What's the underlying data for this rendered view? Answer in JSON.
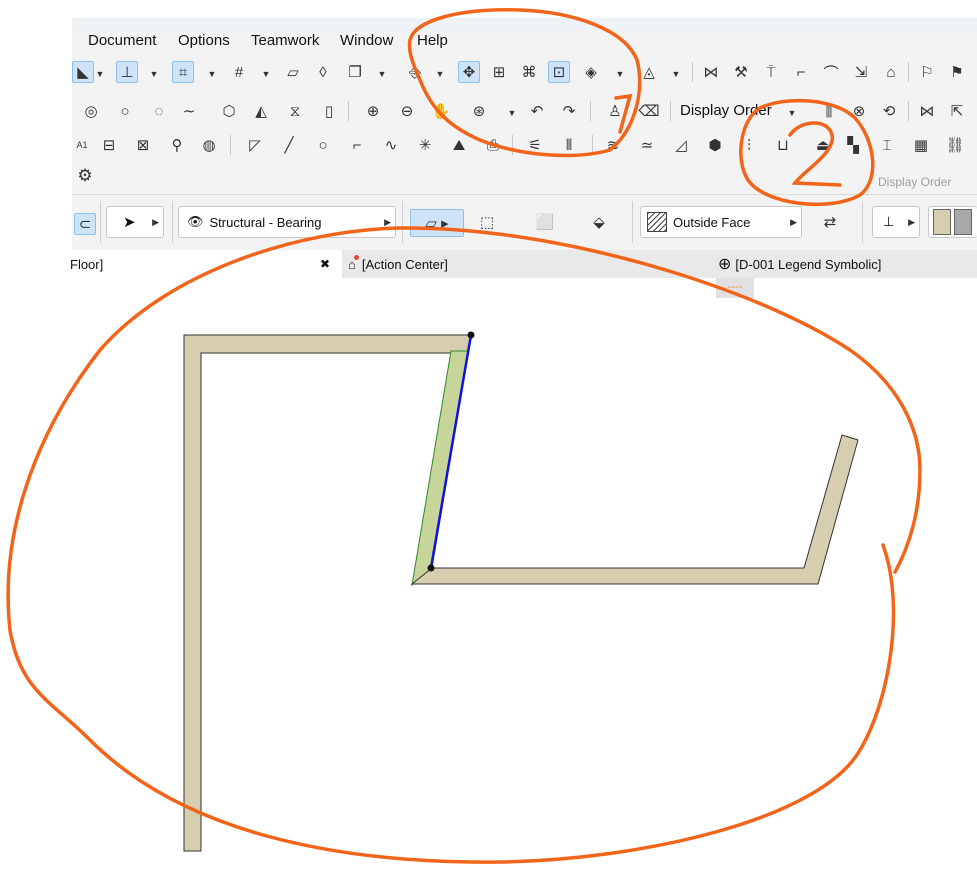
{
  "menu": {
    "document": "Document",
    "options": "Options",
    "teamwork": "Teamwork",
    "window": "Window",
    "help": "Help"
  },
  "toolbar": {
    "display_order_label": "Display Order",
    "display_order_tooltip": "Display Order",
    "label_a1": "A1"
  },
  "info_box": {
    "layer_name": "Structural - Bearing",
    "reference_line": "Outside Face"
  },
  "tabs": {
    "floor_tab": "Floor]",
    "close_glyph": "✖",
    "action_center_tab": "[Action Center]",
    "legend_tab": "[D-001 Legend Symbolic]",
    "legend_marker": "----"
  },
  "annotations": {
    "number_1": "1",
    "number_2": "2"
  },
  "colors": {
    "wall_fill": "#d6ceae",
    "selection_blue": "#1010e0",
    "annotation_orange": "#f26419",
    "edge_green": "#2e8b22"
  }
}
